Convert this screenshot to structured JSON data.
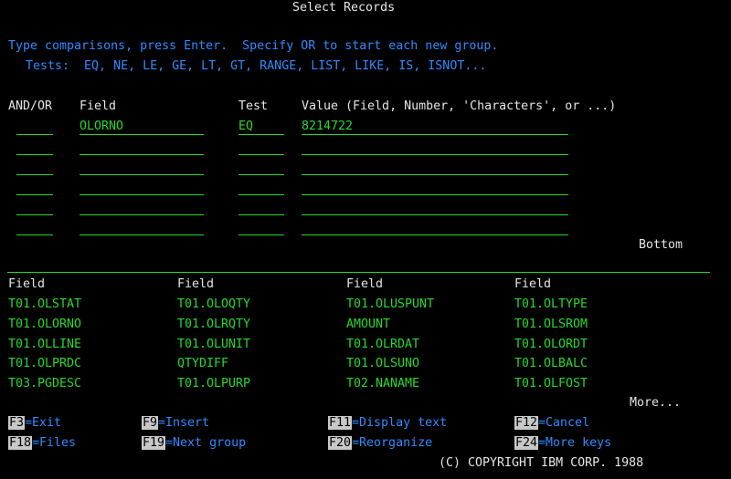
{
  "title": "Select Records",
  "instructions": {
    "line1": "Type comparisons, press Enter.  Specify OR to start each new group.",
    "line2": "Tests:  EQ, NE, LE, GE, LT, GT, RANGE, LIST, LIKE, IS, ISNOT..."
  },
  "headers": {
    "andor": "AND/OR",
    "field": "Field",
    "test": "Test",
    "value": "Value (Field, Number, 'Characters', or ...)"
  },
  "rows": [
    {
      "andor": "",
      "field": "OLORNO",
      "test": "EQ",
      "value": "8214722"
    },
    {
      "andor": "",
      "field": "",
      "test": "",
      "value": ""
    },
    {
      "andor": "",
      "field": "",
      "test": "",
      "value": ""
    },
    {
      "andor": "",
      "field": "",
      "test": "",
      "value": ""
    },
    {
      "andor": "",
      "field": "",
      "test": "",
      "value": ""
    },
    {
      "andor": "",
      "field": "",
      "test": "",
      "value": ""
    }
  ],
  "bottom_label": "Bottom",
  "field_list": {
    "column_header": "Field",
    "columns": [
      [
        "T01.OLSTAT",
        "T01.OLORNO",
        "T01.OLLINE",
        "T01.OLPRDC",
        "T03.PGDESC"
      ],
      [
        "T01.OLOQTY",
        "T01.OLRQTY",
        "T01.OLUNIT",
        "QTYDIFF",
        "T01.OLPURP"
      ],
      [
        "T01.OLUSPUNT",
        "AMOUNT",
        "T01.OLRDAT",
        "T01.OLSUNO",
        "T02.NANAME"
      ],
      [
        "T01.OLTYPE",
        "T01.OLSROM",
        "T01.OLORDT",
        "T01.OLBALC",
        "T01.OLFOST"
      ]
    ]
  },
  "more_label": "More...",
  "function_keys": [
    {
      "key": "F3",
      "label": "=Exit"
    },
    {
      "key": "F9",
      "label": "=Insert"
    },
    {
      "key": "F11",
      "label": "=Display text"
    },
    {
      "key": "F12",
      "label": "=Cancel"
    },
    {
      "key": "F18",
      "label": "=Files"
    },
    {
      "key": "F19",
      "label": "=Next group"
    },
    {
      "key": "F20",
      "label": "=Reorganize"
    },
    {
      "key": "F24",
      "label": "=More keys"
    }
  ],
  "copyright": "(C) COPYRIGHT IBM CORP. 1988",
  "colors": {
    "background": "#000000",
    "text": "#e6e6e6",
    "info": "#2f8cff",
    "input": "#27d82b",
    "key_highlight": "#c8c8c8"
  }
}
